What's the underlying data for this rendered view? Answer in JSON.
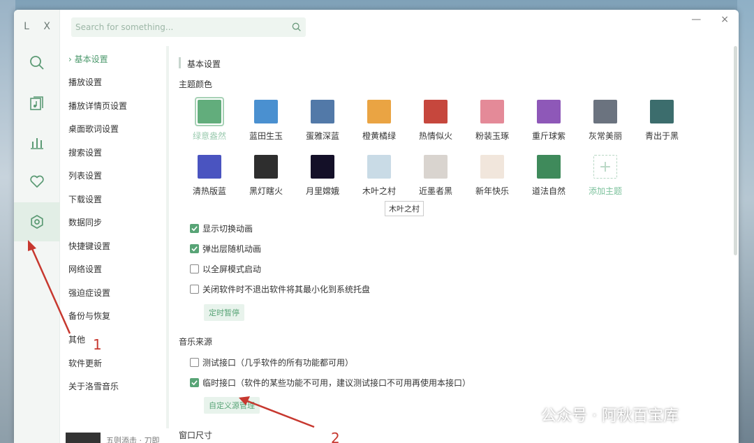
{
  "app": {
    "logo": "L X"
  },
  "search": {
    "placeholder": "Search for something..."
  },
  "window_controls": {
    "minimize": "—",
    "close": "×"
  },
  "nav_icons": [
    {
      "name": "search-icon"
    },
    {
      "name": "music-list-icon"
    },
    {
      "name": "chart-icon"
    },
    {
      "name": "heart-icon"
    },
    {
      "name": "settings-icon",
      "active": true
    }
  ],
  "settings_menu": [
    {
      "label": "基本设置",
      "active": true,
      "prefix": "›"
    },
    {
      "label": "播放设置"
    },
    {
      "label": "播放详情页设置"
    },
    {
      "label": "桌面歌词设置"
    },
    {
      "label": "搜索设置"
    },
    {
      "label": "列表设置"
    },
    {
      "label": "下载设置"
    },
    {
      "label": "数据同步"
    },
    {
      "label": "快捷键设置"
    },
    {
      "label": "网络设置"
    },
    {
      "label": "强迫症设置"
    },
    {
      "label": "备份与恢复"
    },
    {
      "label": "其他"
    },
    {
      "label": "软件更新"
    },
    {
      "label": "关于洛雪音乐"
    }
  ],
  "content": {
    "section_title": "基本设置",
    "theme_title": "主题颜色",
    "themes_row1": [
      {
        "label": "绿意盎然",
        "color": "#62ad7c",
        "selected": true
      },
      {
        "label": "蓝田生玉",
        "color": "#4a90d0"
      },
      {
        "label": "蛋雅深蓝",
        "color": "#5279a8"
      },
      {
        "label": "橙黄橘绿",
        "color": "#eaa443"
      },
      {
        "label": "热情似火",
        "color": "#c6473d"
      },
      {
        "label": "粉装玉琢",
        "color": "#e48a98"
      },
      {
        "label": "重斤球紫",
        "color": "#8e58b8"
      },
      {
        "label": "灰常美丽",
        "color": "#6b737f"
      },
      {
        "label": "青出于黑",
        "color": "#3c6d6d"
      }
    ],
    "themes_row2": [
      {
        "label": "清热版蓝",
        "color": "#4a54c0"
      },
      {
        "label": "黑灯瞎火",
        "color": "#2e2e2e"
      },
      {
        "label": "月里嫦娥",
        "color": "#141028"
      },
      {
        "label": "木叶之村",
        "color": "#c9dbe6"
      },
      {
        "label": "近墨者黑",
        "color": "#d9d4cf"
      },
      {
        "label": "新年快乐",
        "color": "#f1e6dc"
      },
      {
        "label": "道法自然",
        "color": "#3f8a5b"
      },
      {
        "label": "添加主题",
        "add": true,
        "symbol": "+"
      }
    ],
    "tooltip": "木叶之村",
    "options": [
      {
        "label": "显示切换动画",
        "checked": true
      },
      {
        "label": "弹出层随机动画",
        "checked": true
      },
      {
        "label": "以全屏模式启动",
        "checked": false
      },
      {
        "label": "关闭软件时不退出软件将其最小化到系统托盘",
        "checked": false
      }
    ],
    "timer_button": "定时暂停",
    "source_title": "音乐来源",
    "sources": [
      {
        "label": "测试接口（几乎软件的所有功能都可用）",
        "checked": false
      },
      {
        "label": "临时接口（软件的某些功能不可用，建议测试接口不可用再使用本接口）",
        "checked": true
      }
    ],
    "custom_source_button": "自定义源管理",
    "window_size_title": "窗口尺寸"
  },
  "annotations": {
    "one": "1",
    "two": "2",
    "color": "#c7382f"
  },
  "watermark": {
    "text": "公众号 · 阿秋百宝库"
  },
  "player": {
    "text": "五则添击 · 刀即"
  },
  "colors": {
    "accent": "#58a476"
  }
}
